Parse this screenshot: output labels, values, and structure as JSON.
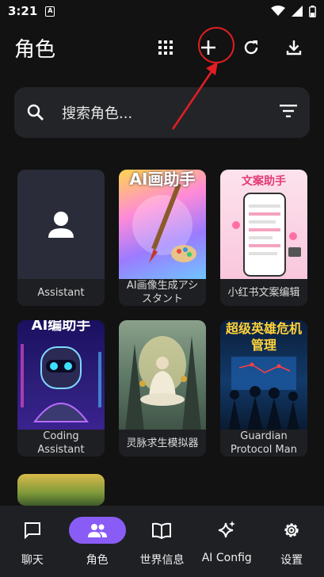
{
  "status": {
    "time": "3:21",
    "sim_label": "A"
  },
  "appbar": {
    "title": "角色",
    "actions": [
      "grid-view",
      "add",
      "refresh",
      "download"
    ]
  },
  "search": {
    "placeholder": "搜索角色..."
  },
  "cards": [
    {
      "label": "Assistant"
    },
    {
      "label": "AI画像生成アシスタント",
      "art_text": "AI画助手"
    },
    {
      "label": "小红书文案编辑",
      "art_text": "文案助手"
    },
    {
      "label": "Coding Assistant",
      "art_text": "AI编助手"
    },
    {
      "label": "灵脉求生模拟器"
    },
    {
      "label": "Guardian Protocol Man",
      "art_text": "超级英雄危机管理"
    },
    {
      "label": ""
    }
  ],
  "nav": {
    "items": [
      {
        "label": "聊天",
        "icon": "chat-icon"
      },
      {
        "label": "角色",
        "icon": "people-icon",
        "active": true
      },
      {
        "label": "世界信息",
        "icon": "book-icon"
      },
      {
        "label": "AI Config",
        "icon": "sparkle-icon"
      },
      {
        "label": "设置",
        "icon": "gear-icon"
      }
    ]
  },
  "colors": {
    "accent": "#8a5cf6",
    "annotation": "#e01e24",
    "background": "#121212"
  }
}
